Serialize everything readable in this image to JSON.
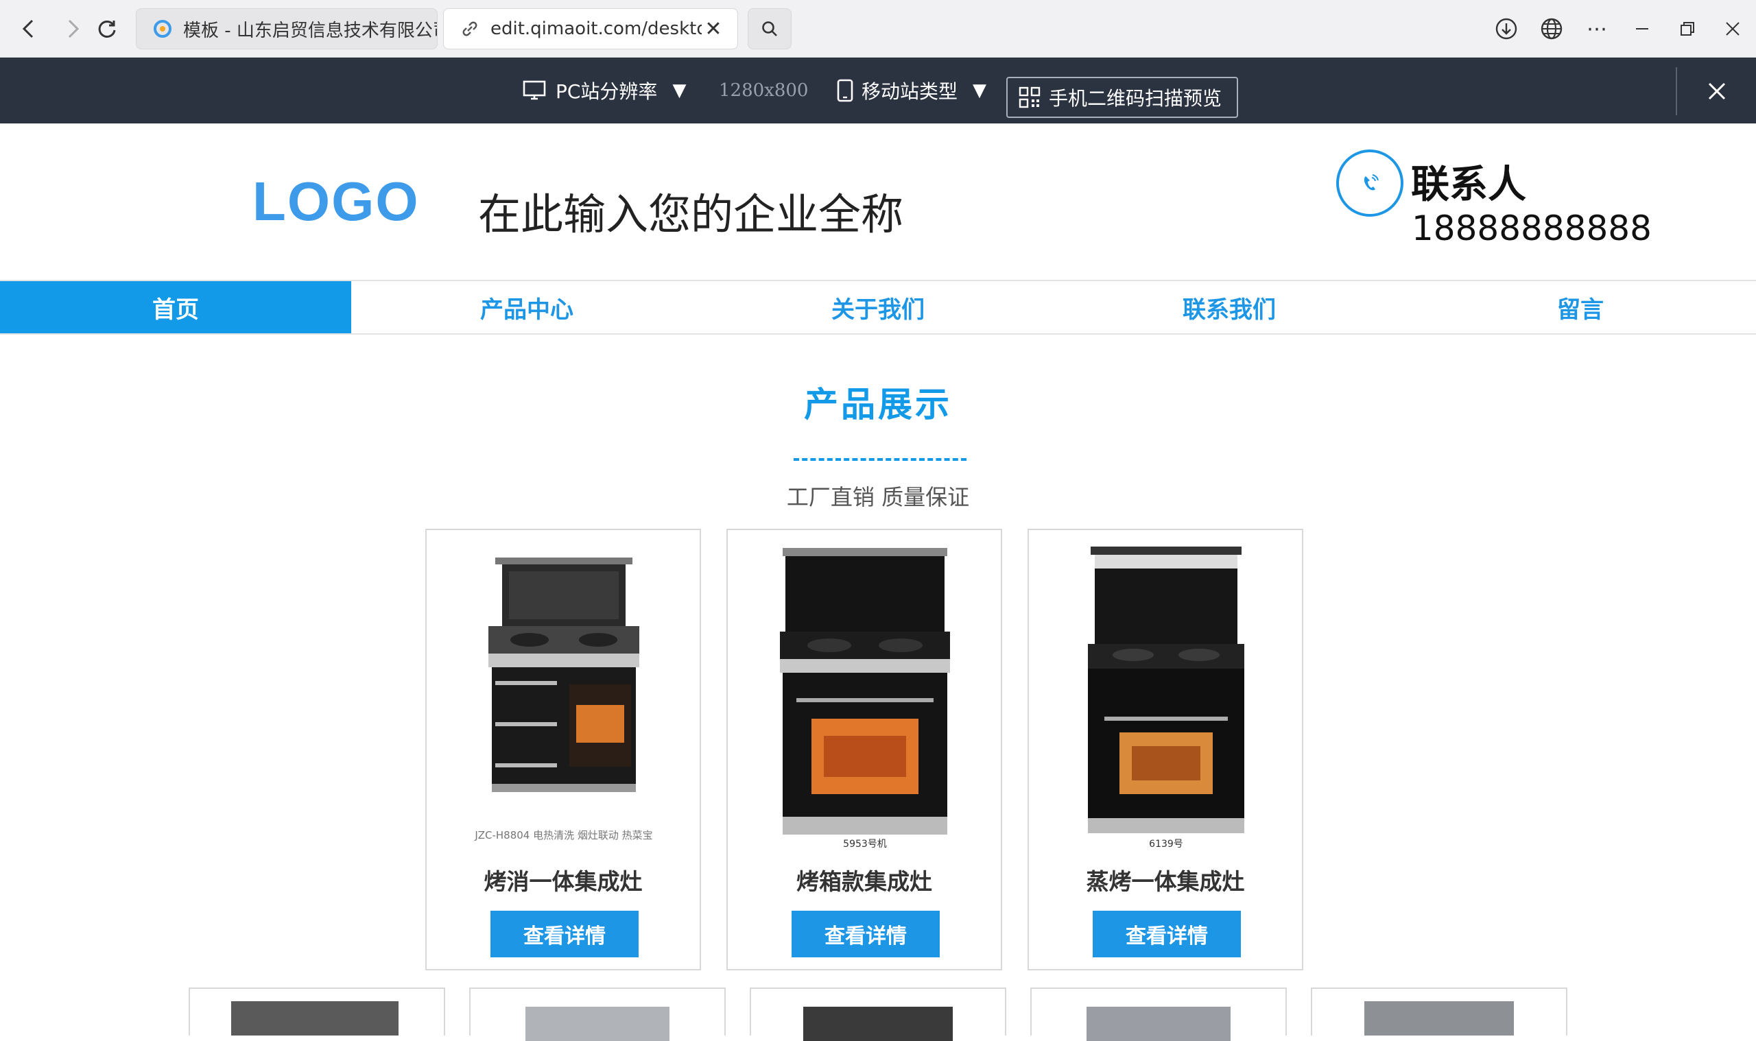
{
  "browser": {
    "tab_inactive_title": "模板 - 山东启贸信息技术有限公司",
    "tab_active_url": "edit.qimaoit.com/desktop/H",
    "colors": {
      "chrome_bg": "#f1f1f3"
    }
  },
  "preview_toolbar": {
    "pc_label": "PC站分辨率",
    "resolution": "1280x800",
    "mobile_label": "移动站类型",
    "qr_label": "手机二维码扫描预览"
  },
  "header": {
    "logo": "LOGO",
    "company_name": "在此输入您的企业全称",
    "contact_label": "联系人",
    "contact_phone": "18888888888"
  },
  "nav": {
    "items": [
      "首页",
      "产品中心",
      "关于我们",
      "联系我们",
      "留言"
    ],
    "active_index": 0
  },
  "section": {
    "title": "产品展示",
    "subtitle": "工厂直销 质量保证"
  },
  "products": [
    {
      "name": "烤消一体集成灶",
      "button": "查看详情",
      "caption": "JZC-H8804  电热清洗 烟灶联动 热菜宝"
    },
    {
      "name": "烤箱款集成灶",
      "button": "查看详情",
      "caption": "5953号机"
    },
    {
      "name": "蒸烤一体集成灶",
      "button": "查看详情",
      "caption": "6139号"
    }
  ],
  "colors": {
    "accent": "#129ae8",
    "toolbar_bg": "#2b3240",
    "logo": "#3d9be9"
  }
}
